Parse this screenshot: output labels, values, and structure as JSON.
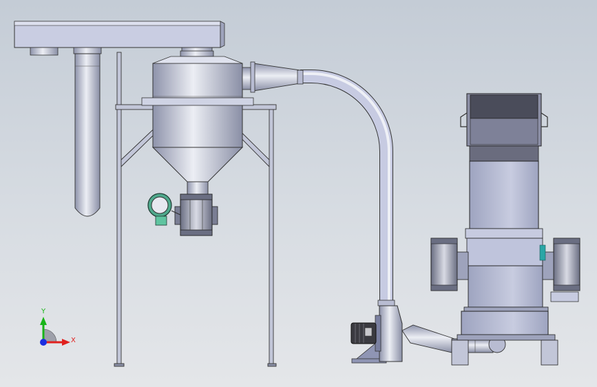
{
  "triad": {
    "y_label": "Y",
    "x_label": "X",
    "colors": {
      "x": "#e0201e",
      "y": "#18b418",
      "z": "#1a2ee0"
    }
  },
  "colors": {
    "background_top": "#c4ccd6",
    "background_bottom": "#e4e6e9",
    "metal_light": "#e4e6ee",
    "metal_mid": "#9aa0b8",
    "metal_dark": "#5a5f72",
    "motor_dark": "#3a3a40",
    "valve_motor_green": "#4fa88c",
    "accent_cyan": "#2aa6a6"
  }
}
